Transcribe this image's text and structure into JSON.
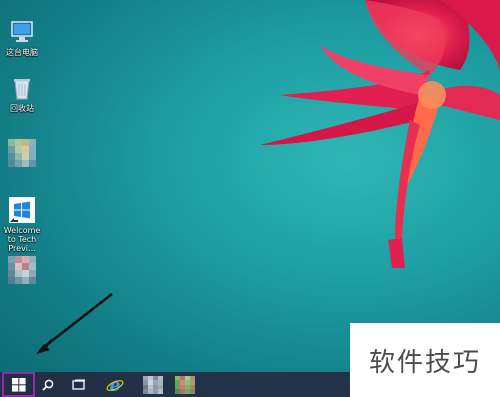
{
  "desktop": {
    "icons": [
      {
        "label": "这台电脑",
        "icon": "computer-icon"
      },
      {
        "label": "回收站",
        "icon": "recycle-bin-icon"
      },
      {
        "label": "",
        "icon": "blurred-app-icon"
      },
      {
        "label": "Welcome to Tech Previ...",
        "icon": "windows-welcome-icon"
      },
      {
        "label": "",
        "icon": "blurred-app-icon"
      }
    ]
  },
  "taskbar": {
    "items": [
      {
        "name": "start",
        "icon": "windows-logo-icon"
      },
      {
        "name": "search",
        "icon": "search-icon"
      },
      {
        "name": "task-view",
        "icon": "task-view-icon"
      },
      {
        "name": "internet-explorer",
        "icon": "ie-icon"
      },
      {
        "name": "pinned-app-1",
        "icon": "blurred-app-icon"
      },
      {
        "name": "pinned-app-2",
        "icon": "blurred-app-icon"
      }
    ]
  },
  "watermark": {
    "text": "软件技巧"
  },
  "colors": {
    "accent_highlight": "#8a2bb0",
    "flower": "#e0204a",
    "wallpaper": "#1e9fa3"
  }
}
